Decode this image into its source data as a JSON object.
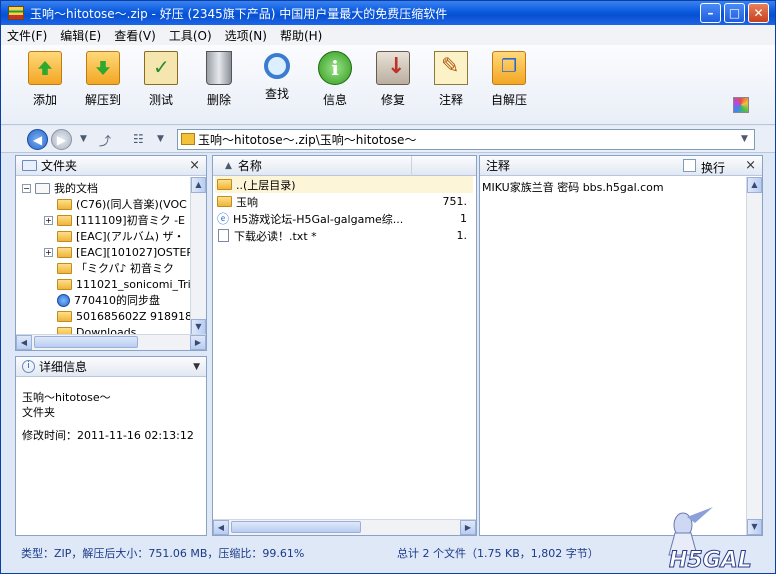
{
  "window": {
    "title": "玉响～hitotose～.zip - 好压 (2345旗下产品) 中国用户量最大的免费压缩软件",
    "minimize_label": "–",
    "maximize_label": "□",
    "close_label": "✕"
  },
  "menu": [
    {
      "label": "文件(F)"
    },
    {
      "label": "编辑(E)"
    },
    {
      "label": "查看(V)"
    },
    {
      "label": "工具(O)"
    },
    {
      "label": "选项(N)"
    },
    {
      "label": "帮助(H)"
    }
  ],
  "toolbar": [
    {
      "label": "添加",
      "icon": "add-icon"
    },
    {
      "label": "解压到",
      "icon": "extract-icon"
    },
    {
      "label": "测试",
      "icon": "test-icon"
    },
    {
      "label": "删除",
      "icon": "delete-icon"
    },
    {
      "label": "查找",
      "icon": "find-icon"
    },
    {
      "label": "信息",
      "icon": "info-icon"
    },
    {
      "label": "修复",
      "icon": "repair-icon"
    },
    {
      "label": "注释",
      "icon": "comment-icon"
    },
    {
      "label": "自解压",
      "icon": "sfx-icon"
    }
  ],
  "address": {
    "path": "玉响～hitotose～.zip\\玉响～hitotose～"
  },
  "folder_pane": {
    "title": "文件夹",
    "close": "×",
    "items": [
      {
        "label": "我的文档"
      },
      {
        "label": "(C76)(同人音楽)(VOC"
      },
      {
        "label": "[111109]初音ミク -E"
      },
      {
        "label": "[EAC](アルバム) ザ・"
      },
      {
        "label": "[EAC][101027]OSTER"
      },
      {
        "label": "「ミクパ♪ 初音ミク"
      },
      {
        "label": "111021_sonicomi_Tri"
      },
      {
        "label": "770410的同步盘"
      },
      {
        "label": "501685602Z 918918"
      },
      {
        "label": "Downloads"
      }
    ]
  },
  "details_pane": {
    "title": "详细信息",
    "name": "玉响～hitotose～",
    "type": "文件夹",
    "modified": "修改时间：2011-11-16 02:13:12"
  },
  "file_list": {
    "column_name": "名称",
    "rows": [
      {
        "name": "..(上层目录)",
        "size": ""
      },
      {
        "name": "玉响",
        "size": "751."
      },
      {
        "name": "H5游戏论坛-H5Gal-galgame综...",
        "size": "1"
      },
      {
        "name": "下载必读！.txt *",
        "size": "1."
      }
    ]
  },
  "comment_pane": {
    "title": "注释",
    "wrap_label": "换行",
    "close": "×",
    "text": "MIKU家族兰音  密码 bbs.h5gal.com"
  },
  "status": {
    "left": "类型：ZIP，解压后大小：751.06 MB，压缩比：99.61%",
    "right": "总计 2 个文件（1.75 KB，1,802 字节）"
  },
  "watermark": {
    "text": "H5GAL"
  }
}
